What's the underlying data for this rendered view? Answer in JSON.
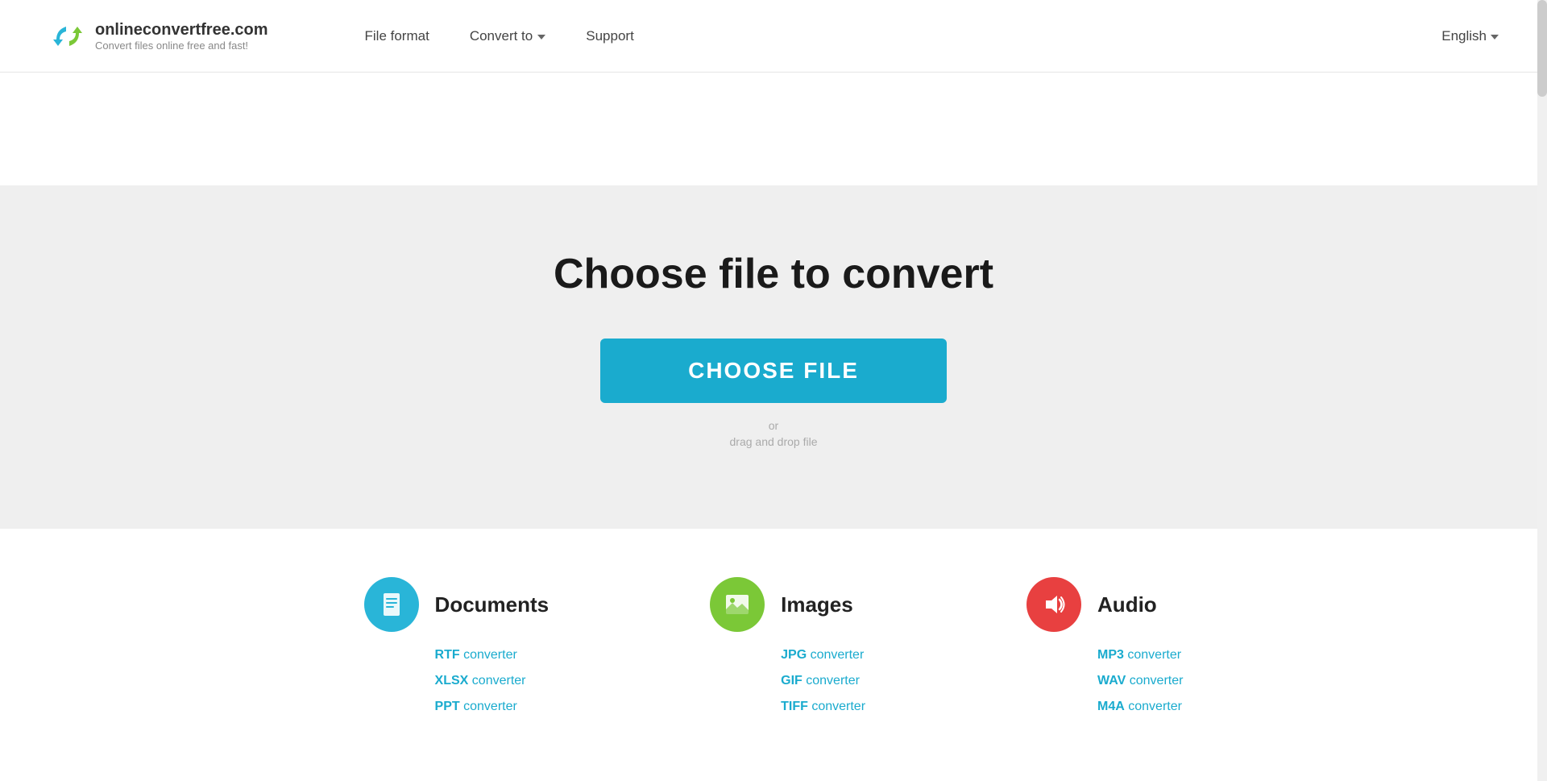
{
  "header": {
    "logo_name": "onlineconvertfree.com",
    "logo_tagline": "Convert files online free and fast!",
    "nav": {
      "file_format": "File format",
      "convert_to": "Convert to",
      "support": "Support"
    },
    "language": "English"
  },
  "main": {
    "title": "Choose file to convert",
    "choose_file_btn": "CHOOSE FILE",
    "or_text": "or",
    "drag_drop_text": "drag and drop file"
  },
  "categories": [
    {
      "id": "documents",
      "title": "Documents",
      "icon_label": "document-icon",
      "links": [
        {
          "format": "RTF",
          "suffix": " converter"
        },
        {
          "format": "XLSX",
          "suffix": " converter"
        },
        {
          "format": "PPT",
          "suffix": " converter"
        }
      ]
    },
    {
      "id": "images",
      "title": "Images",
      "icon_label": "image-icon",
      "links": [
        {
          "format": "JPG",
          "suffix": " converter"
        },
        {
          "format": "GIF",
          "suffix": " converter"
        },
        {
          "format": "TIFF",
          "suffix": " converter"
        }
      ]
    },
    {
      "id": "audio",
      "title": "Audio",
      "icon_label": "audio-icon",
      "links": [
        {
          "format": "MP3",
          "suffix": " converter"
        },
        {
          "format": "WAV",
          "suffix": " converter"
        },
        {
          "format": "M4A",
          "suffix": " converter"
        }
      ]
    }
  ]
}
